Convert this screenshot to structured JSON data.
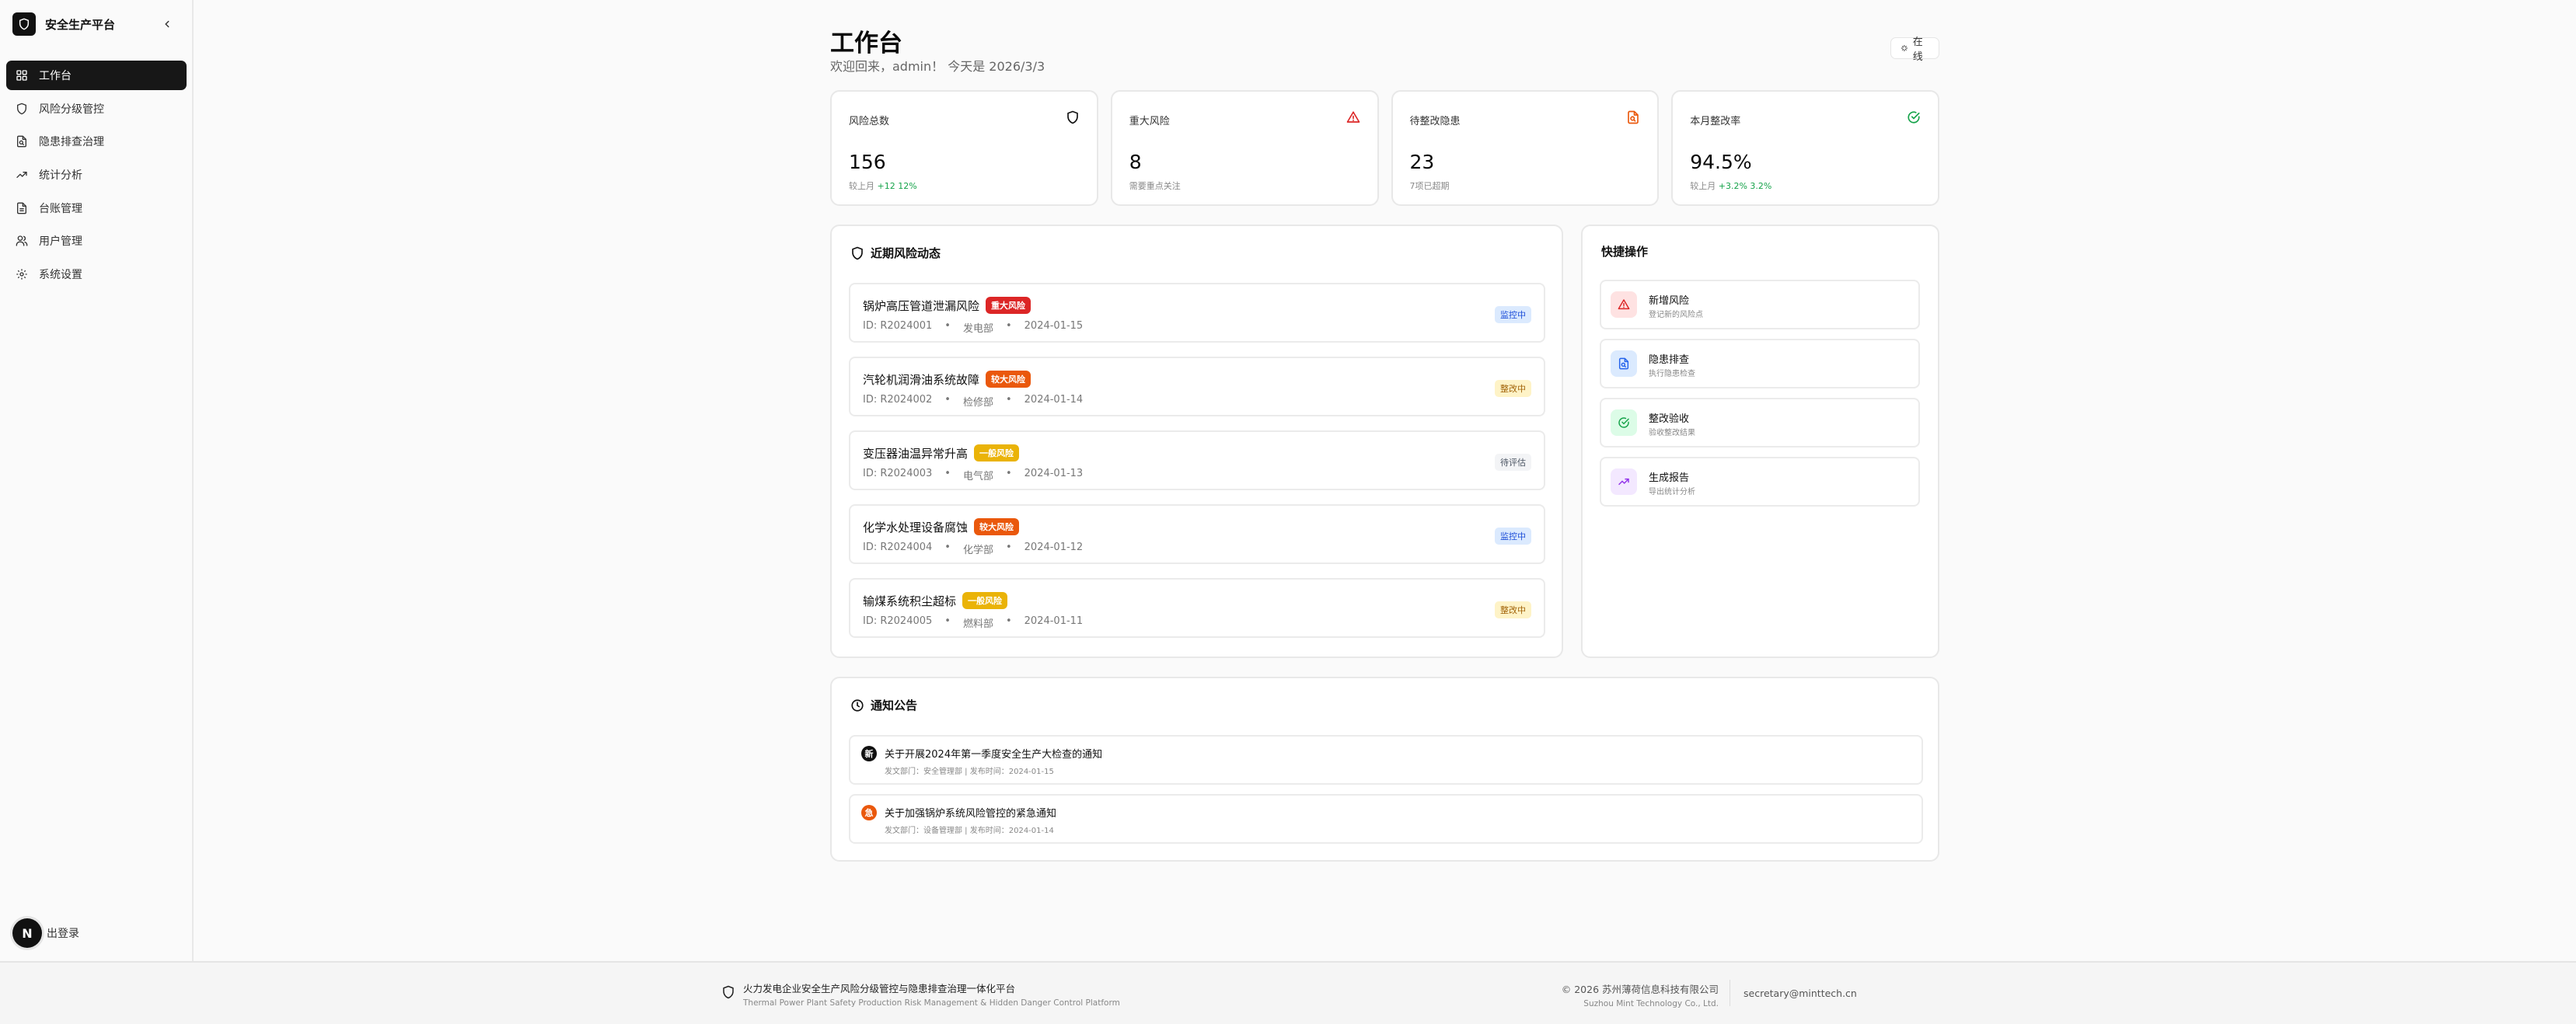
{
  "sidebar": {
    "brand": "安全生产平台",
    "items": [
      {
        "label": "工作台",
        "icon": "grid-icon",
        "active": true
      },
      {
        "label": "风险分级管控",
        "icon": "shield-icon"
      },
      {
        "label": "隐患排查治理",
        "icon": "file-search-icon"
      },
      {
        "label": "统计分析",
        "icon": "trending-up-icon"
      },
      {
        "label": "台账管理",
        "icon": "file-text-icon"
      },
      {
        "label": "用户管理",
        "icon": "users-icon"
      },
      {
        "label": "系统设置",
        "icon": "gear-icon"
      }
    ],
    "logout": "出登录",
    "avatar_letter": "N"
  },
  "header": {
    "title": "工作台",
    "subtitle": "欢迎回来，admin！ 今天是 2026/3/3",
    "status": "在线"
  },
  "stats": [
    {
      "label": "风险总数",
      "value": "156",
      "note": "较上月",
      "delta": "+12 12%",
      "icon": "shield-icon",
      "color": "#111111"
    },
    {
      "label": "重大风险",
      "value": "8",
      "note": "需要重点关注",
      "delta": "",
      "icon": "warning-triangle-icon",
      "color": "#dc2626"
    },
    {
      "label": "待整改隐患",
      "value": "23",
      "note": "7项已超期",
      "delta": "",
      "icon": "file-search-icon",
      "color": "#ea580c"
    },
    {
      "label": "本月整改率",
      "value": "94.5%",
      "note": "较上月",
      "delta": "+3.2% 3.2%",
      "icon": "check-circle-icon",
      "color": "#16a34a"
    }
  ],
  "recent": {
    "title": "近期风险动态",
    "items": [
      {
        "name": "锅炉高压管道泄漏风险",
        "level": "重大风险",
        "level_color": "#dc2626",
        "id": "ID: R2024001",
        "dept": "发电部",
        "date": "2024-01-15",
        "status": "监控中",
        "status_bg": "#dbeafe",
        "status_fg": "#1d4ed8"
      },
      {
        "name": "汽轮机润滑油系统故障",
        "level": "较大风险",
        "level_color": "#ea580c",
        "id": "ID: R2024002",
        "dept": "检修部",
        "date": "2024-01-14",
        "status": "整改中",
        "status_bg": "#fef3c7",
        "status_fg": "#a16207"
      },
      {
        "name": "变压器油温异常升高",
        "level": "一般风险",
        "level_color": "#eab308",
        "id": "ID: R2024003",
        "dept": "电气部",
        "date": "2024-01-13",
        "status": "待评估",
        "status_bg": "#f3f4f6",
        "status_fg": "#4b5563"
      },
      {
        "name": "化学水处理设备腐蚀",
        "level": "较大风险",
        "level_color": "#ea580c",
        "id": "ID: R2024004",
        "dept": "化学部",
        "date": "2024-01-12",
        "status": "监控中",
        "status_bg": "#dbeafe",
        "status_fg": "#1d4ed8"
      },
      {
        "name": "输煤系统积尘超标",
        "level": "一般风险",
        "level_color": "#eab308",
        "id": "ID: R2024005",
        "dept": "燃料部",
        "date": "2024-01-11",
        "status": "整改中",
        "status_bg": "#fef3c7",
        "status_fg": "#a16207"
      }
    ]
  },
  "quick": {
    "title": "快捷操作",
    "items": [
      {
        "label": "新增风险",
        "desc": "登记新的风险点",
        "icon": "warning-triangle-icon",
        "bg": "#fee2e2",
        "fg": "#dc2626"
      },
      {
        "label": "隐患排查",
        "desc": "执行隐患检查",
        "icon": "file-search-icon",
        "bg": "#dbeafe",
        "fg": "#2563eb"
      },
      {
        "label": "整改验收",
        "desc": "验收整改结果",
        "icon": "check-circle-icon",
        "bg": "#dcfce7",
        "fg": "#16a34a"
      },
      {
        "label": "生成报告",
        "desc": "导出统计分析",
        "icon": "trending-up-icon",
        "bg": "#f3e8ff",
        "fg": "#9333ea"
      }
    ]
  },
  "notices": {
    "title": "通知公告",
    "items": [
      {
        "badge": "新",
        "badge_color": "#111111",
        "title": "关于开展2024年第一季度安全生产大检查的通知",
        "meta": "发文部门：安全管理部 | 发布时间：2024-01-15"
      },
      {
        "badge": "急",
        "badge_color": "#ea580c",
        "title": "关于加强锅炉系统风险管控的紧急通知",
        "meta": "发文部门：设备管理部 | 发布时间：2024-01-14"
      }
    ]
  },
  "footer": {
    "title": "火力发电企业安全生产风险分级管控与隐患排查治理一体化平台",
    "subtitle": "Thermal Power Plant Safety Production Risk Management & Hidden Danger Control Platform",
    "copyright": "© 2026 苏州薄荷信息科技有限公司",
    "company_en": "Suzhou Mint Technology Co., Ltd.",
    "email": "secretary@minttech.cn"
  }
}
